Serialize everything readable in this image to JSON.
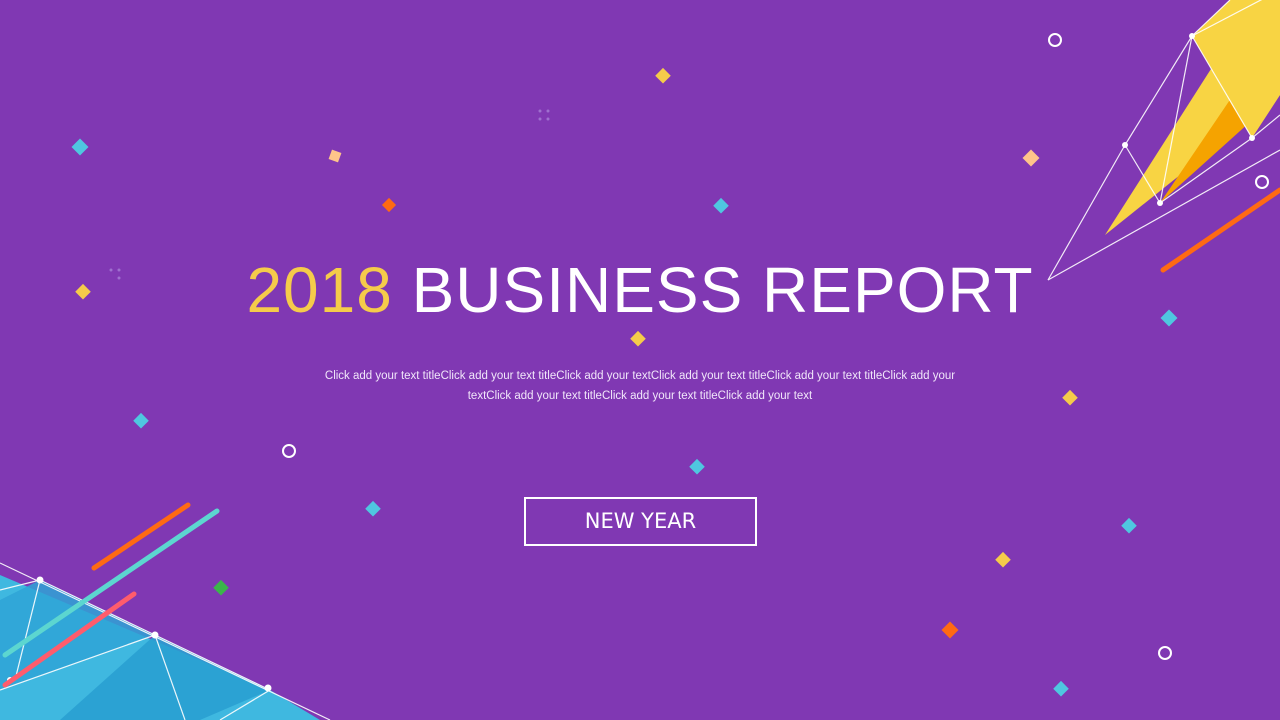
{
  "slide": {
    "title_year": "2018",
    "title_text": "BUSINESS REPORT",
    "subtitle": "Click add your text titleClick add your text titleClick add your textClick add your text titleClick add your text titleClick add your textClick add your text titleClick add your text titleClick add your text",
    "button_label": "NEW YEAR"
  },
  "colors": {
    "background": "#8038b3",
    "accent_yellow": "#f5cb4a",
    "accent_orange": "#f5a300",
    "accent_cyan": "#45c1e5",
    "accent_red": "#ff5c6c",
    "accent_teal": "#5cd6d0",
    "accent_green": "#3bb54a",
    "text": "#ffffff"
  }
}
